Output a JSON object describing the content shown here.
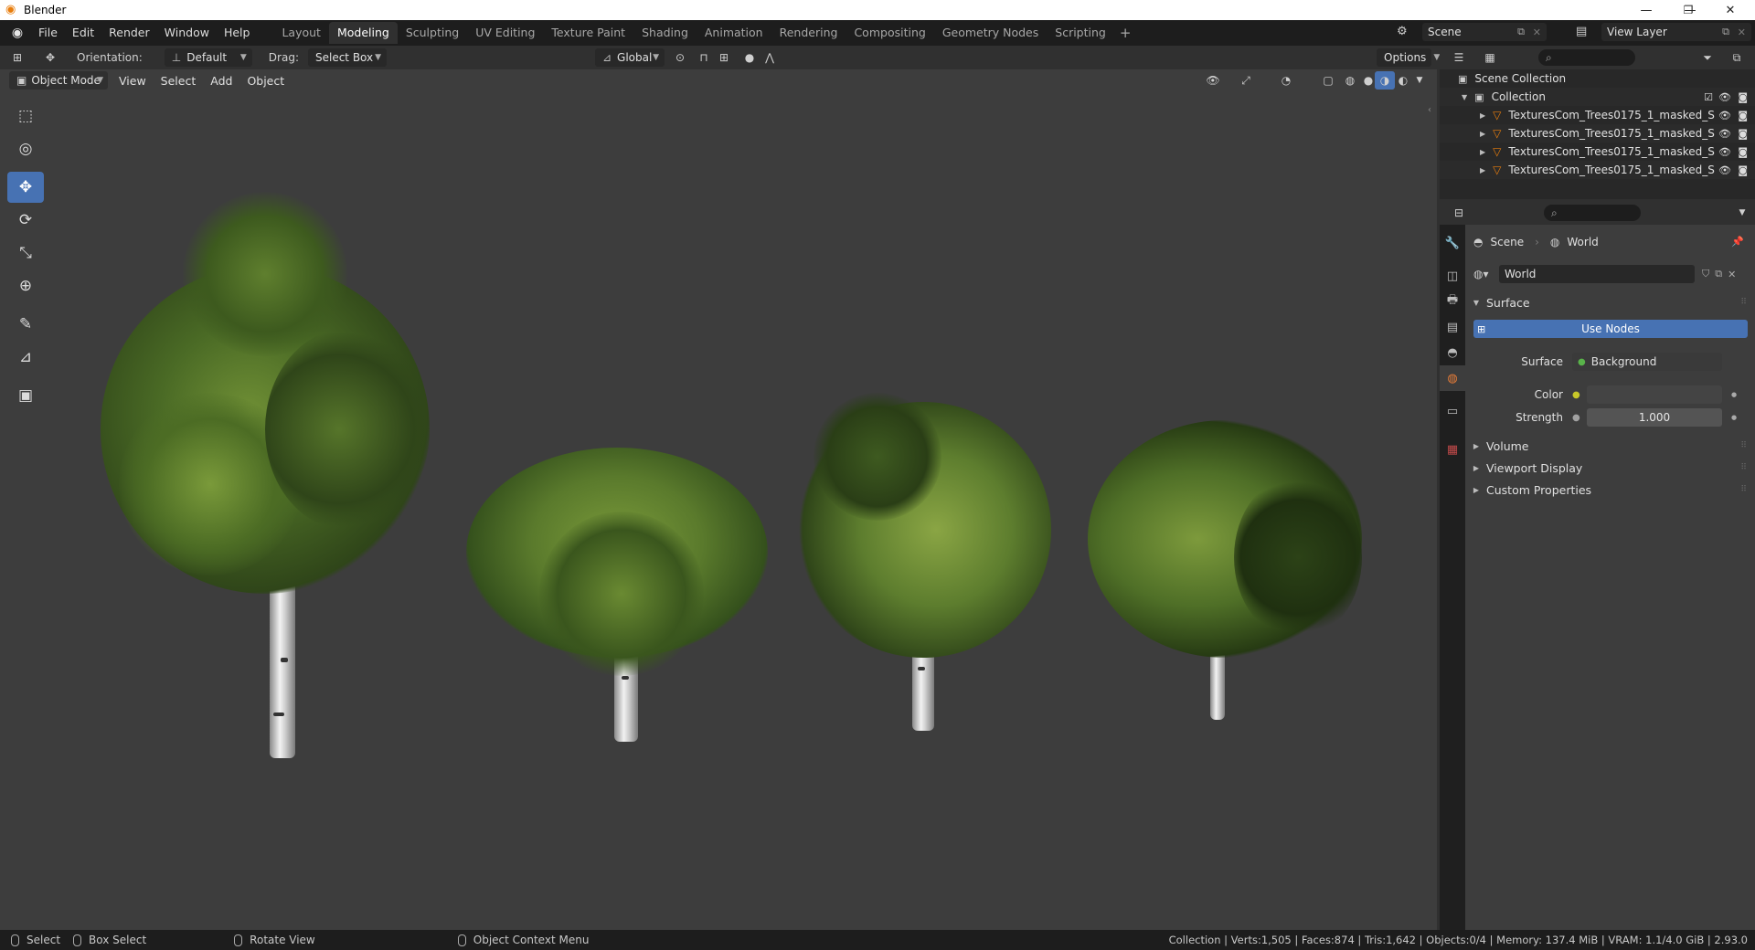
{
  "window": {
    "title": "Blender",
    "minimize": "—",
    "maximize": "❐",
    "close": "✕"
  },
  "menu": [
    "File",
    "Edit",
    "Render",
    "Window",
    "Help"
  ],
  "workspaces": {
    "tabs": [
      "Layout",
      "Modeling",
      "Sculpting",
      "UV Editing",
      "Texture Paint",
      "Shading",
      "Animation",
      "Rendering",
      "Compositing",
      "Geometry Nodes",
      "Scripting"
    ],
    "active": "Modeling",
    "add": "+"
  },
  "scene": {
    "name": "Scene",
    "view_layer": "View Layer"
  },
  "viewport_header": {
    "orientation_label": "Orientation:",
    "orientation_value": "Default",
    "drag_label": "Drag:",
    "drag_value": "Select Box",
    "transform_space": "Global",
    "options": "Options"
  },
  "viewport_header2": {
    "mode": "Object Mode",
    "menus": [
      "View",
      "Select",
      "Add",
      "Object"
    ]
  },
  "tools": [
    {
      "name": "select-box-icon",
      "glyph": "⬚"
    },
    {
      "name": "cursor-icon",
      "glyph": "◎"
    },
    {
      "name": "move-icon",
      "glyph": "✥"
    },
    {
      "name": "rotate-icon",
      "glyph": "⟳"
    },
    {
      "name": "scale-icon",
      "glyph": "⤡"
    },
    {
      "name": "transform-icon",
      "glyph": "⊕"
    },
    {
      "name": "annotate-icon",
      "glyph": "✎"
    },
    {
      "name": "measure-icon",
      "glyph": "📐"
    },
    {
      "name": "add-cube-icon",
      "glyph": "▣"
    }
  ],
  "outliner": {
    "scene_collection": "Scene Collection",
    "collection": "Collection",
    "objects": [
      "TexturesCom_Trees0175_1_masked_S",
      "TexturesCom_Trees0175_1_masked_S",
      "TexturesCom_Trees0175_1_masked_S",
      "TexturesCom_Trees0175_1_masked_S"
    ]
  },
  "properties": {
    "breadcrumb_scene": "Scene",
    "breadcrumb_world": "World",
    "world_name": "World",
    "panels": {
      "surface": "Surface",
      "use_nodes": "Use Nodes",
      "surface_label": "Surface",
      "surface_value": "Background",
      "color_label": "Color",
      "strength_label": "Strength",
      "strength_value": "1.000",
      "volume": "Volume",
      "viewport_display": "Viewport Display",
      "custom_properties": "Custom Properties"
    }
  },
  "status": {
    "select": "Select",
    "box_select": "Box Select",
    "rotate_view": "Rotate View",
    "context_menu": "Object Context Menu",
    "stats": "Collection | Verts:1,505 | Faces:874 | Tris:1,642 | Objects:0/4 | Memory: 137.4 MiB | VRAM: 1.1/4.0 GiB | 2.93.0"
  },
  "colors": {
    "accent": "#4772b3",
    "world_tab": "#e77d38",
    "object_icon": "#e87d0d",
    "foliage_dark": "#2f4519",
    "foliage_light": "#7a9a3a"
  }
}
